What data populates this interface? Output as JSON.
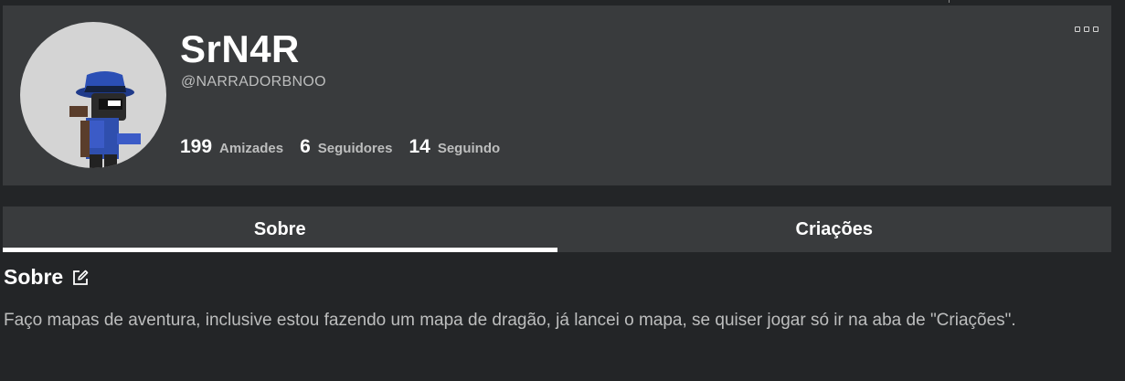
{
  "profile": {
    "display_name": "SrN4R",
    "username": "@NARRADORBNOO",
    "stats": [
      {
        "count": "199",
        "label": "Amizades"
      },
      {
        "count": "6",
        "label": "Seguidores"
      },
      {
        "count": "14",
        "label": "Seguindo"
      }
    ],
    "presence_icon": "user-icon",
    "presence_color": "#00a2ff"
  },
  "tabs": [
    {
      "label": "Sobre",
      "active": true
    },
    {
      "label": "Criações",
      "active": false
    }
  ],
  "about": {
    "title": "Sobre",
    "text": "Faço mapas de aventura, inclusive estou fazendo um mapa de dragão, já lancei o mapa, se quiser jogar só ir na aba de \"Criações\"."
  },
  "colors": {
    "background": "#232527",
    "card": "#393b3d",
    "secondary_text": "#bdbebe"
  }
}
